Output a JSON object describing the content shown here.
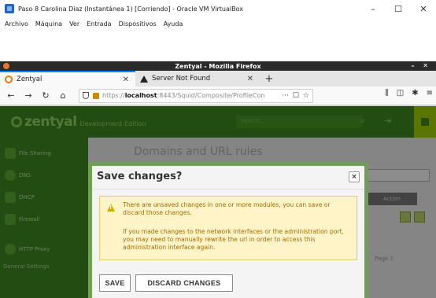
{
  "vbox": {
    "title": "Paso 8 Carolina Diaz (Instantánea 1) [Corriendo] - Oracle VM VirtualBox",
    "controls": {
      "minimize": "–",
      "maximize": "☐",
      "close": "✕"
    },
    "menu": [
      "Archivo",
      "Máquina",
      "Ver",
      "Entrada",
      "Dispositivos",
      "Ayuda"
    ]
  },
  "firefox": {
    "window_title": "Zentyal - Mozilla Firefox",
    "window_controls": "– ✕",
    "tabs": [
      {
        "label": "Zentyal",
        "active": true
      },
      {
        "label": "Server Not Found",
        "active": false
      }
    ],
    "tab_close": "✕",
    "new_tab": "+",
    "nav": {
      "back": "←",
      "forward": "→",
      "reload": "↻",
      "home": "⌂"
    },
    "url": {
      "prefix": "https://",
      "host": "localhost",
      "rest": ":8443/Squid/Composite/ProfileCon"
    },
    "url_actions": {
      "more": "···",
      "pocket": "☐",
      "bookmark": "☆"
    },
    "toolbar_right": {
      "library": "⫼",
      "sidebar": "◫",
      "addons": "✱",
      "menu": "≡"
    }
  },
  "zentyal": {
    "logo": "zentyal",
    "edition": "Development Edition",
    "search_placeholder": "Search...",
    "sidebar": [
      {
        "label": "File Sharing"
      },
      {
        "label": "DNS"
      },
      {
        "label": "DHCP"
      },
      {
        "label": "Firewall"
      },
      {
        "label": "HTTP Proxy"
      }
    ],
    "sidebar_section": "General Settings",
    "page_title": "Domains and URL rules",
    "table_action_header": "Action",
    "pagination": "Page 1"
  },
  "dialog": {
    "title": "Save changes?",
    "close": "×",
    "warning_1": "There are unsaved changes in one or more modules, you can save or discard those changes.",
    "warning_2": "If you made changes to the network interfaces or the administration port, you may need to manually rewrite the url in order to access this administration interface again.",
    "save_label": "SAVE",
    "discard_label": "DISCARD CHANGES"
  }
}
